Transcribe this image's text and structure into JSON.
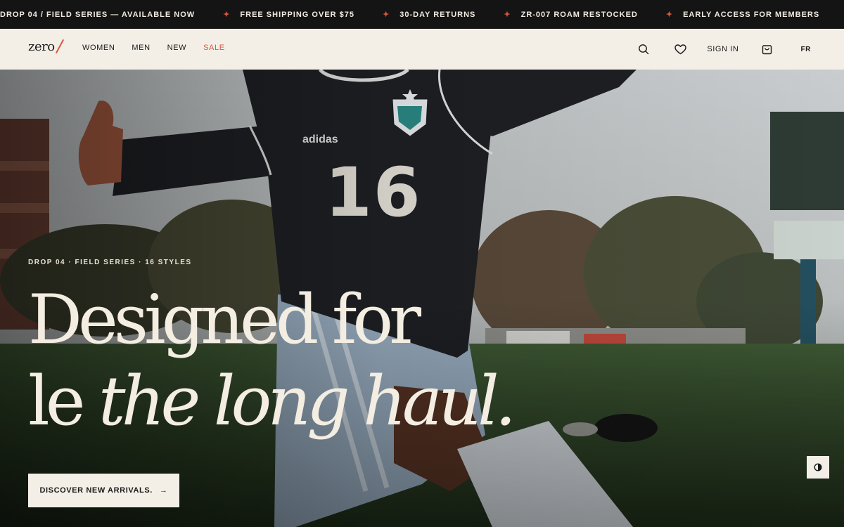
{
  "announcements": [
    "DROP 04 / FIELD SERIES — AVAILABLE NOW",
    "FREE SHIPPING OVER $75",
    "30-DAY RETURNS",
    "ZR-007 ROAM RESTOCKED",
    "EARLY ACCESS FOR MEMBERS"
  ],
  "announcement_separator": "✦",
  "header": {
    "logo": "zero",
    "nav": [
      "WOMEN",
      "MEN",
      "NEW",
      "SALE"
    ],
    "icons": [
      "search-icon",
      "heart-icon",
      "bag-icon"
    ],
    "sign_in": "SIGN IN",
    "language": "FR"
  },
  "hero": {
    "eyebrow": "DROP 04 · FIELD SERIES · 16 STYLES",
    "headline_line1": "Designed for",
    "headline_line2_roman": "le",
    "headline_line2_italic": "the long haul.",
    "cta_label": "DISCOVER NEW ARRIVALS.",
    "cta_arrow": "→",
    "jersey_number": "16",
    "jersey_brand": "adidas"
  },
  "colors": {
    "accent": "#d9553b",
    "cream": "#f3efe7",
    "dark": "#141414"
  },
  "contrast_toggle_icon": "contrast-icon"
}
